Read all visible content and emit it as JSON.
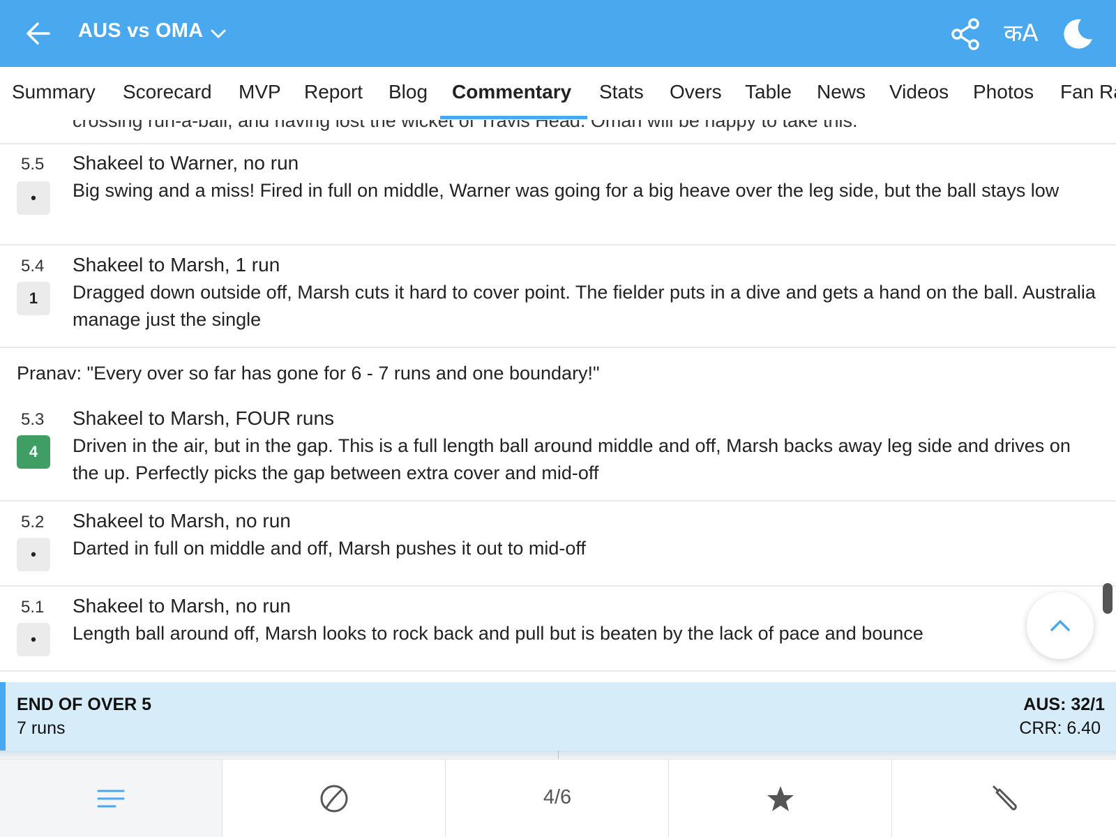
{
  "header": {
    "title": "AUS vs OMA",
    "lang_label": "कA",
    "accent_color": "#4aa8ee"
  },
  "tabs": [
    {
      "label": "Summary"
    },
    {
      "label": "Scorecard"
    },
    {
      "label": "MVP"
    },
    {
      "label": "Report"
    },
    {
      "label": "Blog"
    },
    {
      "label": "Commentary",
      "active": true
    },
    {
      "label": "Stats"
    },
    {
      "label": "Overs"
    },
    {
      "label": "Table"
    },
    {
      "label": "News"
    },
    {
      "label": "Videos"
    },
    {
      "label": "Photos"
    },
    {
      "label": "Fan Ra"
    }
  ],
  "commentary": {
    "clipped_previous": "crossing run-a-ball, and having lost the wicket of Travis Head. Oman will be happy to take this.",
    "balls": [
      {
        "over": "5.5",
        "result": "•",
        "title": "Shakeel to Warner, no run",
        "text": "Big swing and a miss! Fired in full on middle, Warner was going for a big heave over the leg side, but the ball stays low"
      },
      {
        "over": "5.4",
        "result": "1",
        "title": "Shakeel to Marsh, 1 run",
        "text": "Dragged down outside off, Marsh cuts it hard to cover point. The fielder puts in a dive and gets a hand on the ball. Australia manage just the single"
      },
      {
        "over": "5.3",
        "result": "4",
        "title": "Shakeel to Marsh, FOUR runs",
        "text": "Driven in the air, but in the gap. This is a full length ball around middle and off, Marsh backs away leg side and drives on the up. Perfectly picks the gap between extra cover and mid-off"
      },
      {
        "over": "5.2",
        "result": "•",
        "title": "Shakeel to Marsh, no run",
        "text": "Darted in full on middle and off, Marsh pushes it out to mid-off"
      },
      {
        "over": "5.1",
        "result": "•",
        "title": "Shakeel to Marsh, no run",
        "text": "Length ball around off, Marsh looks to rock back and pull but is beaten by the lack of pace and bounce"
      }
    ],
    "note": "Pranav: \"Every over so far has gone for 6 - 7 runs and one boundary!\"",
    "four_color": "#3f9e63"
  },
  "end_of_over": {
    "title": "END OF OVER 5",
    "runs": "7 runs",
    "score": "AUS: 32/1",
    "crr": "CRR: 6.40"
  },
  "bottom_nav": {
    "items": [
      {
        "icon": "commentary-list-icon"
      },
      {
        "icon": "ball-icon"
      },
      {
        "label": "4/6"
      },
      {
        "icon": "star-icon"
      },
      {
        "icon": "bat-icon"
      }
    ]
  }
}
